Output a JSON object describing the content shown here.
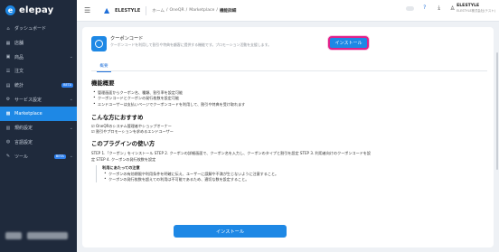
{
  "sidebar": {
    "logo": "elepay",
    "items": [
      {
        "icon": "home-icon",
        "glyph": "⌂",
        "label": "ダッシュボード",
        "chevron": false,
        "badge": ""
      },
      {
        "icon": "store-icon",
        "glyph": "▦",
        "label": "店舗",
        "chevron": false,
        "badge": ""
      },
      {
        "icon": "product-icon",
        "glyph": "▣",
        "label": "商品",
        "chevron": true,
        "badge": ""
      },
      {
        "icon": "order-icon",
        "glyph": "☰",
        "label": "注文",
        "chevron": false,
        "badge": ""
      },
      {
        "icon": "stats-icon",
        "glyph": "▤",
        "label": "統計",
        "chevron": false,
        "badge": "BETA"
      },
      {
        "icon": "service-icon",
        "glyph": "⚙",
        "label": "サービス設定",
        "chevron": true,
        "badge": ""
      },
      {
        "icon": "marketplace-icon",
        "glyph": "▩",
        "label": "Marketplace",
        "chevron": false,
        "badge": "",
        "active": true
      },
      {
        "icon": "contract-icon",
        "glyph": "▥",
        "label": "規約設定",
        "chevron": true,
        "badge": ""
      },
      {
        "icon": "language-icon",
        "glyph": "◍",
        "label": "言語設定",
        "chevron": false,
        "badge": ""
      },
      {
        "icon": "tools-icon",
        "glyph": "✎",
        "label": "ツール",
        "chevron": true,
        "badge": "BETA"
      }
    ]
  },
  "topbar": {
    "brand": "ELESTYLE",
    "breadcrumbs": [
      "ホーム",
      "/",
      "OneQR",
      "/",
      "Marketplace",
      "/"
    ],
    "current": "機能詳細",
    "user_name": "ELESTYLE",
    "user_org": "ELESTYLE株式会社(テスト)"
  },
  "plugin": {
    "title": "クーポンコード",
    "description": "クーポンコードを利用して割引や特典を顧客に提供する機能です。プロモーション活動を支援します。",
    "install_label": "インストール",
    "tab_overview": "概要"
  },
  "content": {
    "overview_heading": "機能概要",
    "overview_items": [
      "管理画面からクーポン名、種類、割引率を設定可能",
      "クーポンコードとクーポンの発行枚数を設定可能",
      "エンドユーザーは支払いページでクーポンコードを利用して、割引や特典を受け取れます"
    ],
    "recommend_heading": "こんな方におすすめ",
    "recommend_items": [
      "OneQRのシステム管理者やショップオーナー",
      "割引やプロモーションを求めるエンドユーザー"
    ],
    "usage_heading": "このプラグインの使い方",
    "usage_text": "STEP 1.「クーポン」をインストール STEP 2. クーポンの詳細画面で、クーポン名を入力し、クーポンのタイプと割引を設定 STEP 3. 利用者向けのクーポンコードを設定 STEP 4. クーポンの発行枚数を設定",
    "notes_title": "利用にあたっての注意",
    "notes": [
      "クーポンの有効期限や利用条件を明確に伝え、ユーザーに誤解や不満が生じないように注意すること。",
      "クーポンの発行枚数を超えての利用は不可能であるため、適切な数を設定すること。"
    ],
    "install_bottom_label": "インストール"
  },
  "colors": {
    "sidebar_bg": "#1f2a3c",
    "accent": "#1e88e5",
    "highlight_border": "#e0218a"
  }
}
